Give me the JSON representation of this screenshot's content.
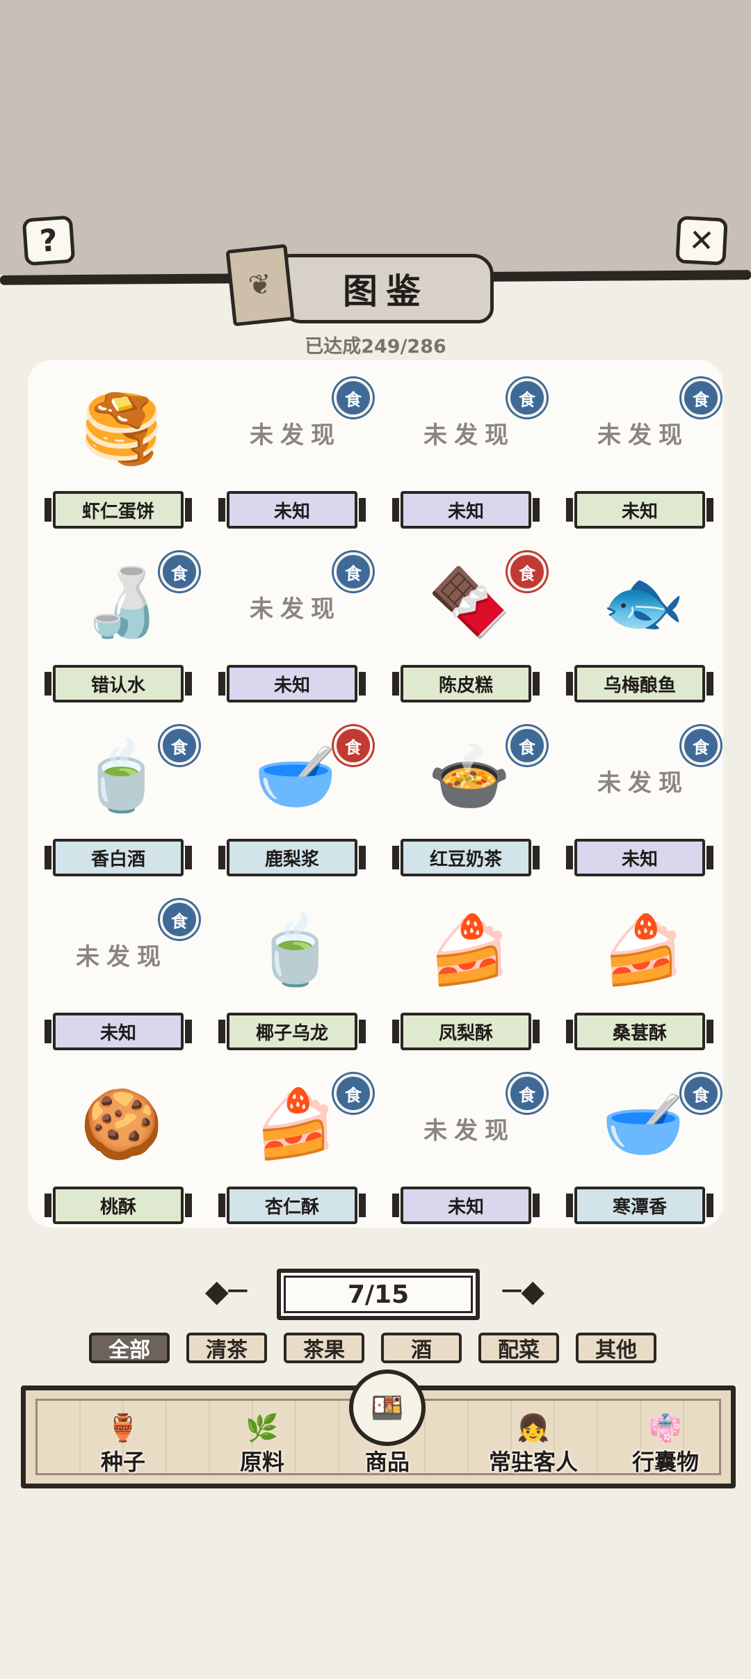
{
  "header": {
    "title": "图鉴",
    "progress": "已达成249/286"
  },
  "buttons": {
    "help_glyph": "?",
    "close_glyph": "✕"
  },
  "undiscovered_text": "未发现",
  "items": [
    {
      "name": "虾仁蛋饼",
      "label_color": "green",
      "discovered": true,
      "badge": ""
    },
    {
      "name": "未知",
      "label_color": "purple",
      "discovered": false,
      "badge": "blue"
    },
    {
      "name": "未知",
      "label_color": "purple",
      "discovered": false,
      "badge": "blue"
    },
    {
      "name": "未知",
      "label_color": "green",
      "discovered": false,
      "badge": "blue"
    },
    {
      "name": "错认水",
      "label_color": "green",
      "discovered": true,
      "badge": "blue"
    },
    {
      "name": "未知",
      "label_color": "purple",
      "discovered": false,
      "badge": "blue"
    },
    {
      "name": "陈皮糕",
      "label_color": "green",
      "discovered": true,
      "badge": "red"
    },
    {
      "name": "乌梅酿鱼",
      "label_color": "green",
      "discovered": true,
      "badge": ""
    },
    {
      "name": "香白酒",
      "label_color": "blue",
      "discovered": true,
      "badge": "blue"
    },
    {
      "name": "鹿梨浆",
      "label_color": "blue",
      "discovered": true,
      "badge": "red"
    },
    {
      "name": "红豆奶茶",
      "label_color": "blue",
      "discovered": true,
      "badge": "blue"
    },
    {
      "name": "未知",
      "label_color": "purple",
      "discovered": false,
      "badge": "blue"
    },
    {
      "name": "未知",
      "label_color": "purple",
      "discovered": false,
      "badge": "blue"
    },
    {
      "name": "椰子乌龙",
      "label_color": "green",
      "discovered": true,
      "badge": ""
    },
    {
      "name": "凤梨酥",
      "label_color": "green",
      "discovered": true,
      "badge": ""
    },
    {
      "name": "桑葚酥",
      "label_color": "green",
      "discovered": true,
      "badge": ""
    },
    {
      "name": "桃酥",
      "label_color": "green",
      "discovered": true,
      "badge": ""
    },
    {
      "name": "杏仁酥",
      "label_color": "blue",
      "discovered": true,
      "badge": "blue"
    },
    {
      "name": "未知",
      "label_color": "purple",
      "discovered": false,
      "badge": "blue"
    },
    {
      "name": "寒潭香",
      "label_color": "blue",
      "discovered": true,
      "badge": "blue"
    }
  ],
  "pager": {
    "text": "7/15"
  },
  "filters": [
    "全部",
    "清茶",
    "茶果",
    "酒",
    "配菜",
    "其他"
  ],
  "active_filter": 0,
  "nav": [
    "种子",
    "原料",
    "商品",
    "常驻客人",
    "行囊物"
  ],
  "active_nav": 2,
  "colors": {
    "label_green": "#dfe9cf",
    "label_purple": "#d9d7ee",
    "label_blue": "#d2e3ea",
    "badge_blue": "#3f6a97",
    "badge_red": "#c13a34"
  }
}
